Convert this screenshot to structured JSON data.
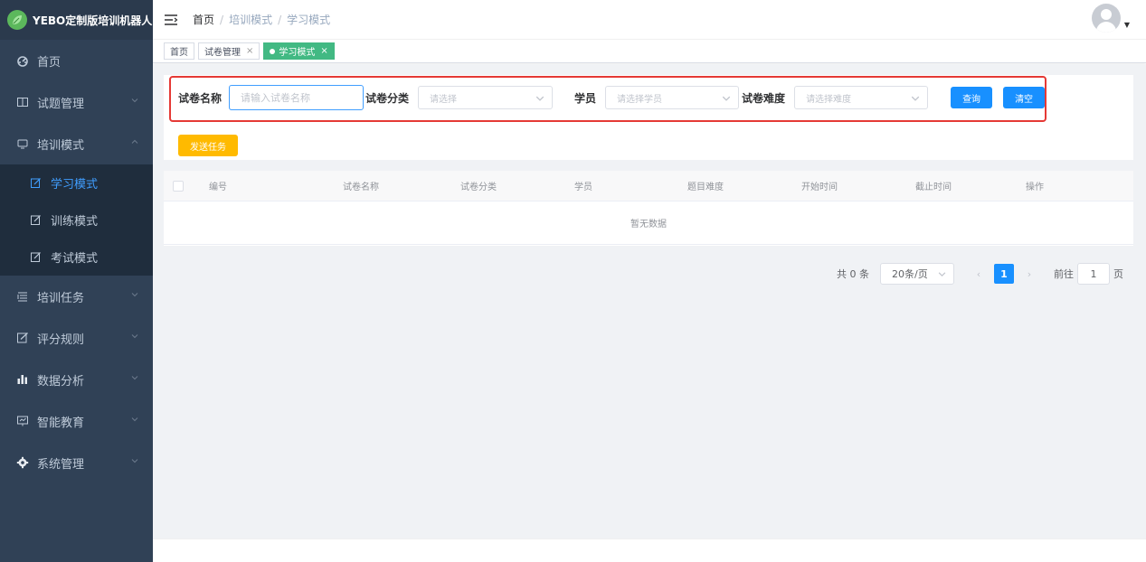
{
  "app": {
    "title": "YEBO定制版培训机器人"
  },
  "sidebar": {
    "items": [
      {
        "label": "首页",
        "icon": "dashboard-icon"
      },
      {
        "label": "试题管理",
        "icon": "book-icon"
      },
      {
        "label": "培训模式",
        "icon": "monitor-icon"
      },
      {
        "label": "培训任务",
        "icon": "list-icon"
      },
      {
        "label": "评分规则",
        "icon": "edit-icon"
      },
      {
        "label": "数据分析",
        "icon": "bar-chart-icon"
      },
      {
        "label": "智能教育",
        "icon": "screen-icon"
      },
      {
        "label": "系统管理",
        "icon": "gear-icon"
      }
    ],
    "submenu": [
      {
        "label": "学习模式",
        "active": true
      },
      {
        "label": "训练模式",
        "active": false
      },
      {
        "label": "考试模式",
        "active": false
      }
    ]
  },
  "breadcrumb": {
    "home": "首页",
    "parent": "培训模式",
    "current": "学习模式",
    "sep": "/"
  },
  "tags": [
    {
      "label": "首页",
      "closable": false,
      "active": false
    },
    {
      "label": "试卷管理",
      "closable": true,
      "active": false
    },
    {
      "label": "学习模式",
      "closable": true,
      "active": true
    }
  ],
  "filters": {
    "name_label": "试卷名称",
    "name_placeholder": "请输入试卷名称",
    "category_label": "试卷分类",
    "category_placeholder": "请选择",
    "student_label": "学员",
    "student_placeholder": "请选择学员",
    "difficulty_label": "试卷难度",
    "difficulty_placeholder": "请选择难度",
    "query_button": "查询",
    "clear_button": "清空",
    "send_button": "发送任务"
  },
  "table": {
    "columns": [
      "编号",
      "试卷名称",
      "试卷分类",
      "学员",
      "题目难度",
      "开始时间",
      "截止时间",
      "操作"
    ],
    "empty_text": "暂无数据"
  },
  "pagination": {
    "total_text": "共 0 条",
    "page_size": "20条/页",
    "current_page": "1",
    "goto_label": "前往",
    "goto_value": "1",
    "page_suffix": "页"
  },
  "colors": {
    "sidebar_bg": "#304156",
    "submenu_bg": "#1f2d3d",
    "active_text": "#409eff",
    "primary": "#1890ff",
    "warning": "#ffba00",
    "active_tag": "#42b983",
    "highlight_box": "#e53935"
  }
}
